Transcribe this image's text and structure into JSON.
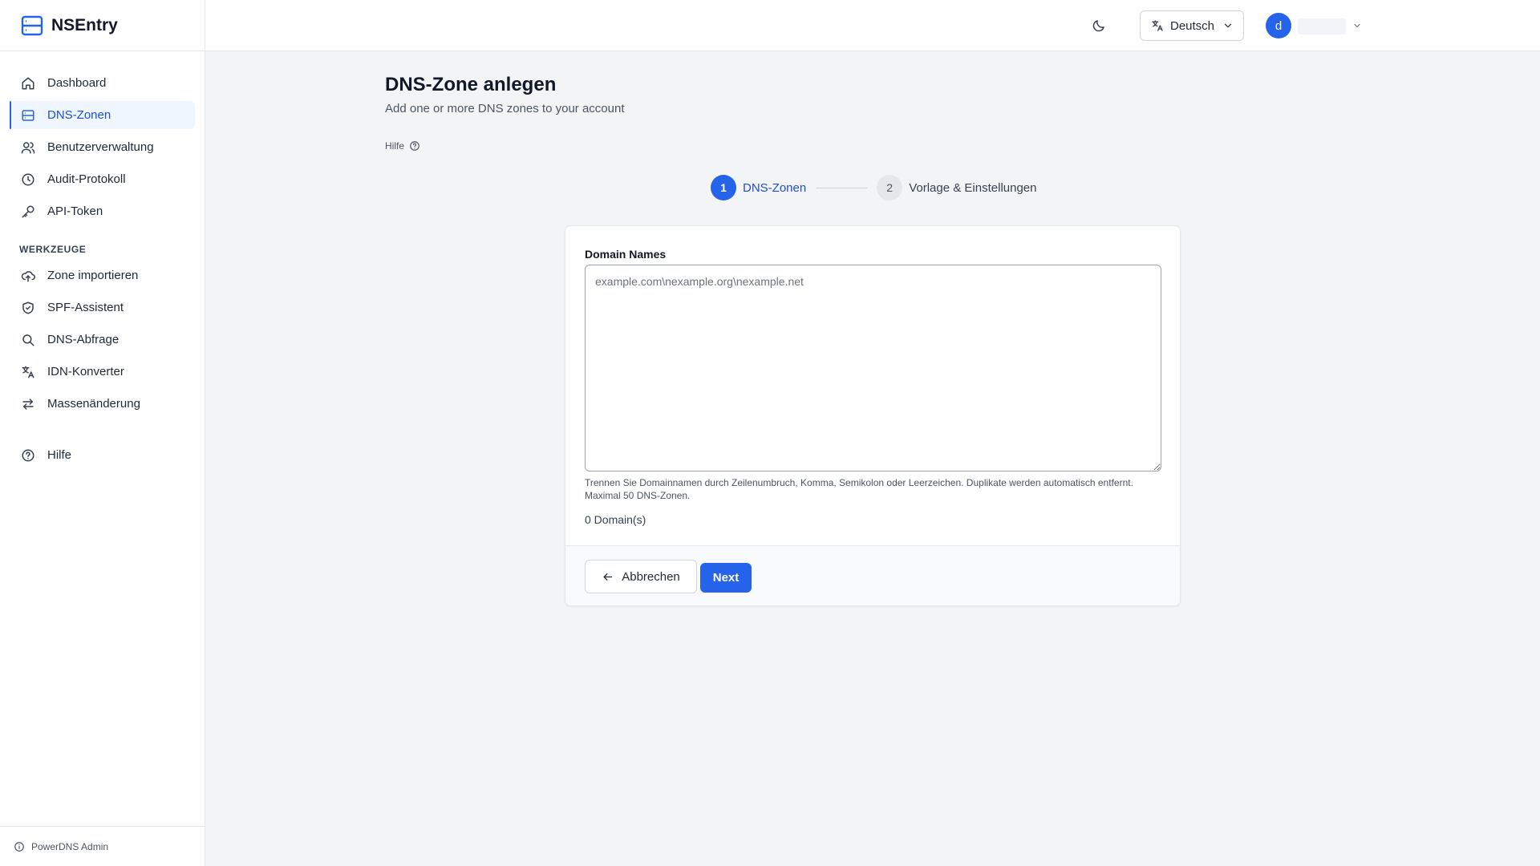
{
  "app": {
    "name": "NSEntry",
    "footer_label": "PowerDNS Admin"
  },
  "sidebar": {
    "items": [
      {
        "label": "Dashboard",
        "icon": "home-icon",
        "active": false
      },
      {
        "label": "DNS-Zonen",
        "icon": "server-icon",
        "active": true
      },
      {
        "label": "Benutzerverwaltung",
        "icon": "users-icon",
        "active": false
      },
      {
        "label": "Audit-Protokoll",
        "icon": "clock-icon",
        "active": false
      },
      {
        "label": "API-Token",
        "icon": "key-icon",
        "active": false
      }
    ],
    "tools_heading": "WERKZEUGE",
    "tools": [
      {
        "label": "Zone importieren",
        "icon": "cloud-upload-icon"
      },
      {
        "label": "SPF-Assistent",
        "icon": "shield-check-icon"
      },
      {
        "label": "DNS-Abfrage",
        "icon": "search-icon"
      },
      {
        "label": "IDN-Konverter",
        "icon": "translate-icon"
      },
      {
        "label": "Massenänderung",
        "icon": "arrows-exchange-icon"
      }
    ],
    "help": {
      "label": "Hilfe",
      "icon": "help-circle-icon"
    }
  },
  "topbar": {
    "language": "Deutsch",
    "avatar_initial": "d"
  },
  "page": {
    "title": "DNS-Zone anlegen",
    "subtitle": "Add one or more DNS zones to your account",
    "help_link": "Hilfe"
  },
  "stepper": {
    "steps": [
      {
        "number": "1",
        "label": "DNS-Zonen",
        "active": true
      },
      {
        "number": "2",
        "label": "Vorlage & Einstellungen",
        "active": false
      }
    ]
  },
  "form": {
    "label": "Domain Names",
    "value": "",
    "placeholder": "example.com\\nexample.org\\nexample.net",
    "hint": "Trennen Sie Domainnamen durch Zeilenumbruch, Komma, Semikolon oder Leerzeichen. Duplikate werden automatisch entfernt. Maximal 50 DNS-Zonen.",
    "count": "0 Domain(s)",
    "cancel_label": "Abbrechen",
    "next_label": "Next"
  },
  "colors": {
    "accent": "#2563eb",
    "active_bg": "#eff6ff",
    "background": "#f3f4f6"
  }
}
